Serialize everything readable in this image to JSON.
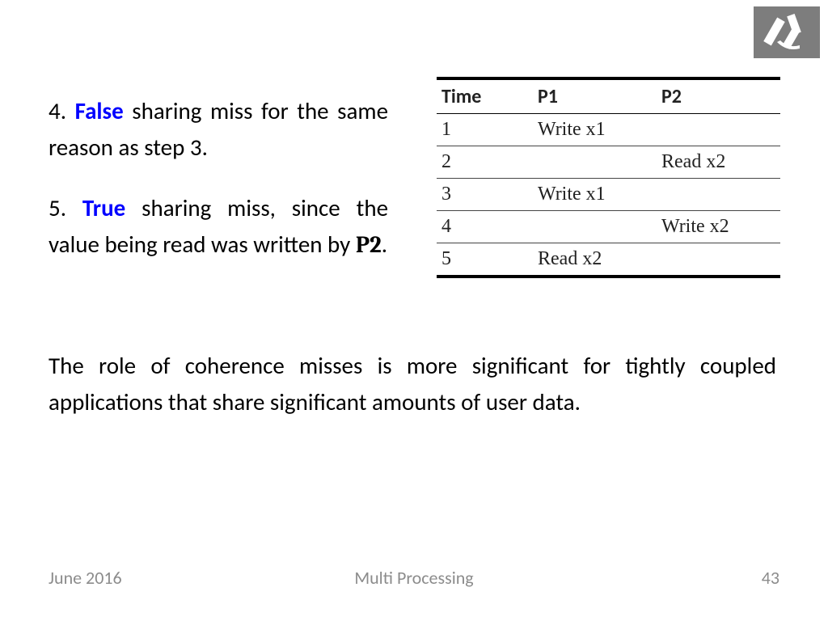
{
  "points": {
    "p4_num": "4. ",
    "p4_kw": "False",
    "p4_rest": " sharing miss for the same reason as step 3.",
    "p5_num": "5. ",
    "p5_kw": "True",
    "p5_mid": " sharing miss, since the value being read was written by ",
    "p5_proc": "P2",
    "p5_end": "."
  },
  "table": {
    "headers": {
      "time": "Time",
      "p1": "P1",
      "p2": "P2"
    },
    "rows": [
      {
        "time": "1",
        "p1": "Write x1",
        "p2": ""
      },
      {
        "time": "2",
        "p1": "",
        "p2": "Read x2"
      },
      {
        "time": "3",
        "p1": "Write x1",
        "p2": ""
      },
      {
        "time": "4",
        "p1": "",
        "p2": "Write x2"
      },
      {
        "time": "5",
        "p1": "Read x2",
        "p2": ""
      }
    ]
  },
  "chart_data": {
    "type": "table",
    "title": "",
    "columns": [
      "Time",
      "P1",
      "P2"
    ],
    "rows": [
      [
        "1",
        "Write x1",
        ""
      ],
      [
        "2",
        "",
        "Read x2"
      ],
      [
        "3",
        "Write x1",
        ""
      ],
      [
        "4",
        "",
        "Write x2"
      ],
      [
        "5",
        "Read x2",
        ""
      ]
    ]
  },
  "paragraph": "The role of coherence misses is more significant for tightly coupled applications that share significant amounts of user data.",
  "footer": {
    "date": "June 2016",
    "title": "Multi Processing",
    "page": "43"
  },
  "logo_name": "aleph-logo"
}
